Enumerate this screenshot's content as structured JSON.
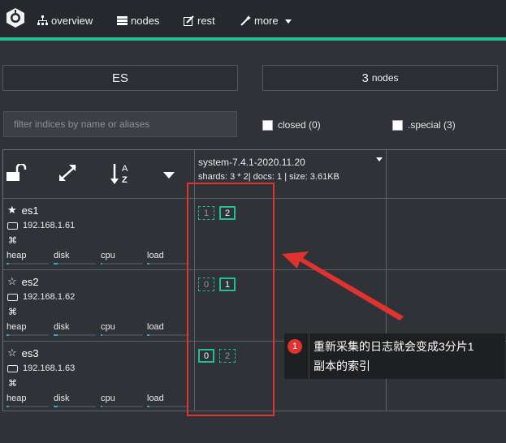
{
  "nav": {
    "overview": "overview",
    "nodes": "nodes",
    "rest": "rest",
    "more": "more"
  },
  "summary": {
    "cluster_name": "ES",
    "node_count": "3",
    "node_count_label": "nodes"
  },
  "filter": {
    "placeholder": "filter indices by name or aliases",
    "closed_label": "closed (0)",
    "special_label": ".special (3)"
  },
  "index": {
    "name": "system-7.4.1-2020.11.20",
    "meta": "shards: 3 * 2| docs: 1 | size: 3.61KB"
  },
  "metric_labels": [
    "heap",
    "disk",
    "cpu",
    "load"
  ],
  "nodes": [
    {
      "name": "es1",
      "ip": "192.168.1.61",
      "master": true,
      "metrics": {
        "heap": 0.06,
        "disk": 0.1,
        "cpu": 0.04,
        "load": 0.06
      },
      "shards": [
        {
          "id": "1",
          "primary": false
        },
        {
          "id": "2",
          "primary": true
        }
      ]
    },
    {
      "name": "es2",
      "ip": "192.168.1.62",
      "master": false,
      "metrics": {
        "heap": 0.06,
        "disk": 0.1,
        "cpu": 0.04,
        "load": 0.06
      },
      "shards": [
        {
          "id": "0",
          "primary": false
        },
        {
          "id": "1",
          "primary": true
        }
      ]
    },
    {
      "name": "es3",
      "ip": "192.168.1.63",
      "master": false,
      "metrics": {
        "heap": 0.06,
        "disk": 0.1,
        "cpu": 0.04,
        "load": 0.06
      },
      "shards": [
        {
          "id": "0",
          "primary": true
        },
        {
          "id": "2",
          "primary": false
        }
      ]
    }
  ],
  "annotation": {
    "number": "1",
    "line1": "重新采集的日志就会变成3分片1",
    "line2": "副本的索引"
  },
  "colors": {
    "accent": "#1fbf8f",
    "annotation_red": "#e0322f",
    "metric_bar": "#2aa8d8"
  }
}
